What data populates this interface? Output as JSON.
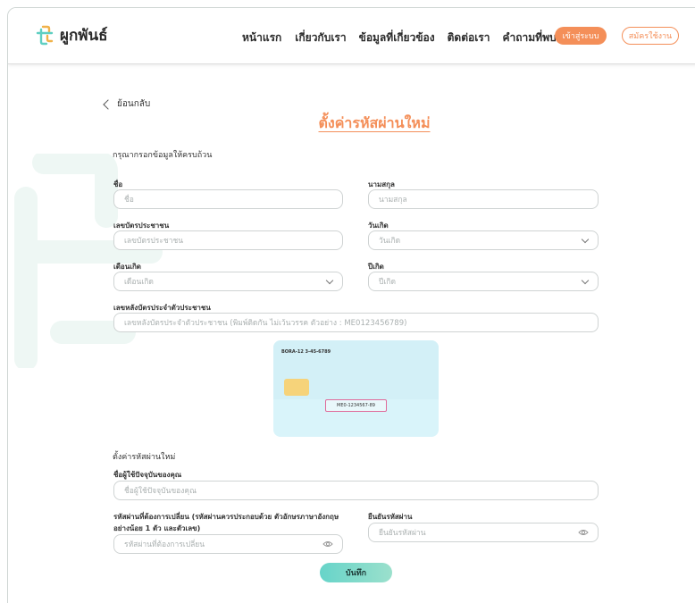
{
  "header": {
    "brand": "ผูกพันธ์",
    "nav": [
      "หน้าแรก",
      "เกี่ยวกับเรา",
      "ข้อมูลที่เกี่ยวข้อง",
      "ติดต่อเรา",
      "คำถามที่พบบ่อย"
    ],
    "login_label": "เข้าสู่ระบบ",
    "register_label": "สมัครใช้งาน"
  },
  "back_label": "ย้อนกลับ",
  "page_title": "ตั้งค่ารหัสผ่านใหม่",
  "section_note": "กรุณากรอกข้อมูลให้ครบถ้วน",
  "form": {
    "first_name": {
      "label": "ชื่อ",
      "placeholder": "ชื่อ"
    },
    "last_name": {
      "label": "นามสกุล",
      "placeholder": "นามสกุล"
    },
    "id_number": {
      "label": "เลขบัตรประชาชน",
      "placeholder": "เลขบัตรประชาชน"
    },
    "birth_day": {
      "label": "วันเกิด",
      "placeholder": "วันเกิด"
    },
    "birth_month": {
      "label": "เดือนเกิด",
      "placeholder": "เดือนเกิด"
    },
    "birth_year": {
      "label": "ปีเกิด",
      "placeholder": "ปีเกิด"
    },
    "laser_code": {
      "label": "เลขหลังบัตรประจำตัวประชาชน",
      "placeholder": "เลขหลังบัตรประจำตัวประชาชน (พิมพ์ติดกัน ไม่เว้นวรรค ตัวอย่าง : ME0123456789)"
    }
  },
  "card": {
    "front_number": "BORA-12 3-45-6789",
    "laser_code": "ME0-1234567-89"
  },
  "reset": {
    "section_title": "ตั้งค่ารหัสผ่านใหม่",
    "username": {
      "label": "ชื่อผู้ใช้ปัจจุบันของคุณ",
      "placeholder": "ชื่อผู้ใช้ปัจจุบันของคุณ"
    },
    "new_password": {
      "label_line1": "รหัสผ่านที่ต้องการเปลี่ยน (รหัสผ่านควรประกอบด้วย ตัวอักษรภาษาอังกฤษ",
      "label_line2": "อย่างน้อย 1 ตัว และตัวเลข)",
      "placeholder": "รหัสผ่านที่ต้องการเปลี่ยน"
    },
    "confirm_password": {
      "label": "ยืนยันรหัสผ่าน",
      "placeholder": "ยืนยันรหัสผ่าน"
    }
  },
  "save_label": "บันทึก",
  "colors": {
    "accent": "#f48f59",
    "teal": "#67d4c9",
    "card": "#d3f0f7"
  }
}
